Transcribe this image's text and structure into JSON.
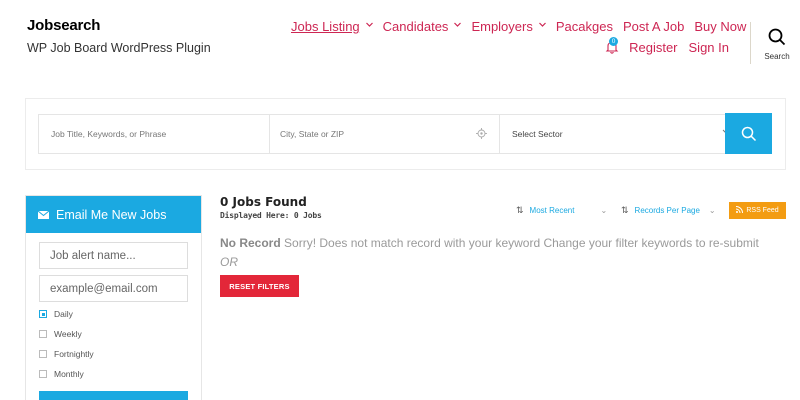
{
  "site": {
    "title": "Jobsearch",
    "tagline": "WP Job Board WordPress Plugin"
  },
  "nav": {
    "primary": [
      {
        "label": "Jobs Listing",
        "active": true,
        "dropdown": true
      },
      {
        "label": "Candidates",
        "active": false,
        "dropdown": true
      },
      {
        "label": "Employers",
        "active": false,
        "dropdown": true
      },
      {
        "label": "Pacakges",
        "active": false,
        "dropdown": false
      },
      {
        "label": "Post A Job",
        "active": false,
        "dropdown": false
      },
      {
        "label": "Buy Now",
        "active": false,
        "dropdown": false
      }
    ],
    "notification_count": "0",
    "register_label": "Register",
    "signin_label": "Sign In",
    "search_label": "Search",
    "link_color": "#cd2653"
  },
  "search": {
    "keyword_placeholder": "Job Title, Keywords, or Phrase",
    "location_placeholder": "City, State or ZIP",
    "sector_label": "Select Sector",
    "accent": "#1ba9e1"
  },
  "sidebar": {
    "title": "Email Me New Jobs",
    "alert_name_placeholder": "Job alert name...",
    "email_placeholder": "example@email.com",
    "frequencies": [
      {
        "label": "Daily",
        "checked": true
      },
      {
        "label": "Weekly",
        "checked": false
      },
      {
        "label": "Fortnightly",
        "checked": false
      },
      {
        "label": "Monthly",
        "checked": false
      }
    ]
  },
  "results": {
    "count_text": "0 Jobs Found",
    "displayed_text": "Displayed Here: 0 Jobs",
    "sort_label": "Most Recent",
    "per_page_label": "Records Per Page",
    "rss_label": "RSS Feed",
    "no_record_title": "No Record",
    "no_record_message": "Sorry!  Does not match record with your keyword  Change your filter keywords to re-submit",
    "or_text": "OR",
    "reset_label": "RESET FILTERS",
    "reset_color": "#e32739",
    "rss_color": "#f39c12"
  }
}
